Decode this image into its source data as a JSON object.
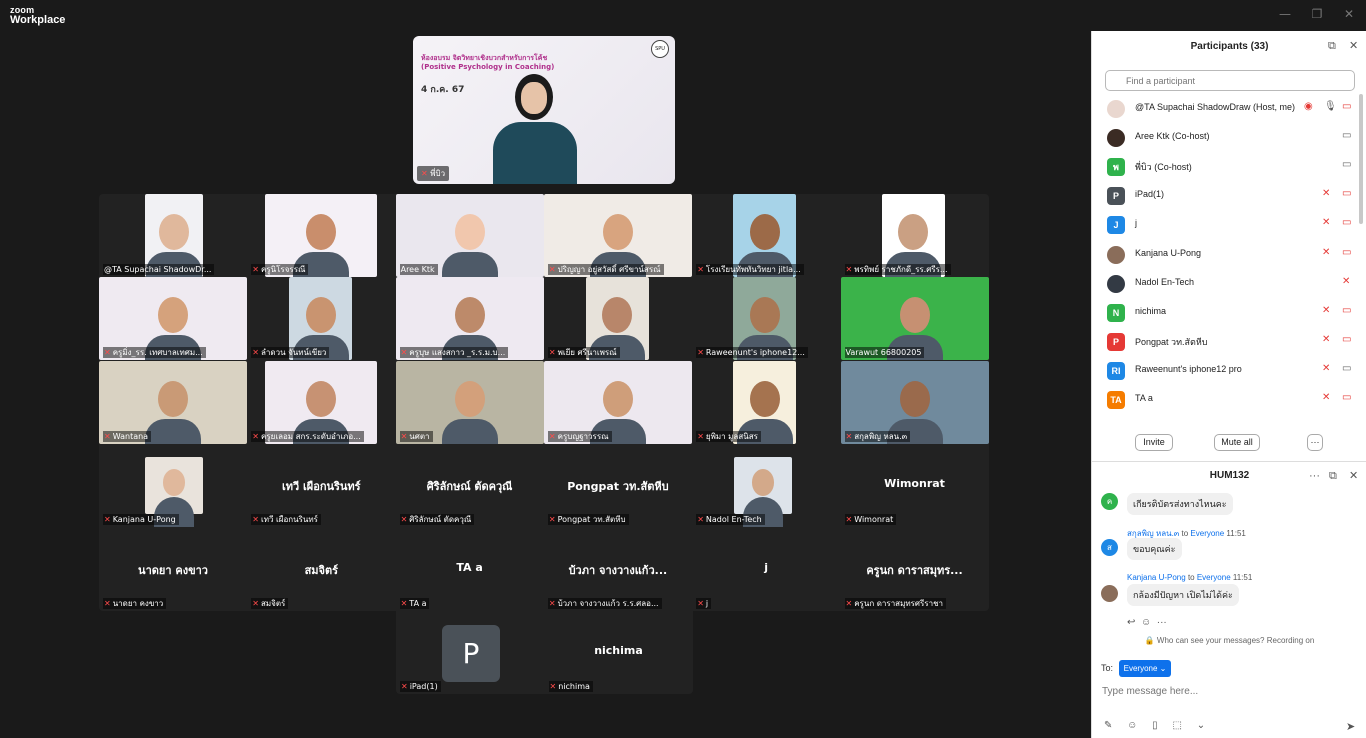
{
  "app": {
    "brand_line1": "zoom",
    "brand_line2": "Workplace"
  },
  "share": {
    "title": "ห้องอบรม จิตวิทยาเชิงบวกสำหรับการโค้ช (Positive Psychology in Coaching)",
    "date": "4 ก.ค. 67",
    "logo": "SPU",
    "presenter_label": "พี่บิว"
  },
  "tiles": [
    {
      "label": "@TA Supachai ShadowDr...",
      "muted": false
    },
    {
      "label": "ครูนิโรจรรณี",
      "muted": true
    },
    {
      "label": "Aree  Ktk",
      "muted": false
    },
    {
      "label": "ปริญญา อยู่สวัสดิ์ ศรีขาน์สรณ์",
      "muted": true
    },
    {
      "label": "โรงเรียนทัพทันวิทยา jitla...",
      "muted": true
    },
    {
      "label": "พรทิพย์ ราชภักดี_รร.ศรีร...",
      "muted": true
    },
    {
      "label": "ครูมิ่ง_รร. เทศบาลเทศม...",
      "muted": true
    },
    {
      "label": "ลำดวน จันทน์เขียว",
      "muted": true
    },
    {
      "label": "ครูบุษ แสงสกาว _ร.ร.ม.บ...",
      "muted": true
    },
    {
      "label": "พเยีย ศรีนาเพรณ์",
      "muted": true
    },
    {
      "label": "Raweenunt's iphone12...",
      "muted": true
    },
    {
      "label": "Varawut 66800205",
      "muted": false
    },
    {
      "label": "Wantana",
      "muted": true
    },
    {
      "label": "ครูยเลอม สกร.ระดับอำเภอ...",
      "muted": true
    },
    {
      "label": "นศตา",
      "muted": true
    },
    {
      "label": "ครูบญฐาวรรณ",
      "muted": true
    },
    {
      "label": "ยุพิมา มูลสนิสร",
      "muted": true
    },
    {
      "label": "สกุลพิญ หลน.๓",
      "muted": true
    },
    {
      "label": "Kanjana U-Pong",
      "muted": true
    },
    {
      "label": "เทวี เผือกนรินทร์",
      "muted": true,
      "big": "เทวี เผือกนรินทร์"
    },
    {
      "label": "ศิริลักษณ์ ตัดควุณี",
      "muted": true,
      "big": "ศิริลักษณ์ ตัดควุณี"
    },
    {
      "label": "Pongpat วท.สัตหีบ",
      "muted": true,
      "big": "Pongpat วท.สัตหีบ"
    },
    {
      "label": "Nadol En-Tech",
      "muted": true
    },
    {
      "label": "Wimonrat",
      "muted": true,
      "big": "Wimonrat"
    },
    {
      "label": "นาดยา คงขาว",
      "muted": true,
      "big": "นาดยา คงขาว"
    },
    {
      "label": "สมจิตร์",
      "muted": true,
      "big": "สมจิตร์"
    },
    {
      "label": "TA a",
      "muted": true,
      "big": "TA a"
    },
    {
      "label": "บ้วภา จางวางแก้ว ร.ร.ศลอ...",
      "muted": true,
      "big": "บ้วภา จางวางแก้ว..."
    },
    {
      "label": "j",
      "muted": true,
      "big": "j"
    },
    {
      "label": "ครูนก ดาราสมุทรศรีราชา",
      "muted": true,
      "big": "ครูนก ดาราสมุทร..."
    },
    {
      "label": "iPad(1)",
      "muted": true,
      "letter": "P"
    },
    {
      "label": "nichima",
      "muted": true,
      "big": "nichima"
    }
  ],
  "participants_panel": {
    "title": "Participants (33)",
    "search_placeholder": "Find a participant",
    "rows": [
      {
        "name": "@TA Supachai ShadowDraw (Host, me)",
        "avatar": "",
        "color": "#e9d7cf"
      },
      {
        "name": "Aree  Ktk (Co-host)",
        "avatar": "",
        "color": "#3b2b24"
      },
      {
        "name": "พี่บิว (Co-host)",
        "avatar": "พ",
        "color": "#2fb24c"
      },
      {
        "name": "iPad(1)",
        "avatar": "P",
        "color": "#4a5158"
      },
      {
        "name": "j",
        "avatar": "J",
        "color": "#1e88e5"
      },
      {
        "name": "Kanjana U-Pong",
        "avatar": "",
        "color": "#8a6d5a"
      },
      {
        "name": "Nadol En-Tech",
        "avatar": "",
        "color": "#333a44"
      },
      {
        "name": "nichima",
        "avatar": "N",
        "color": "#2fb24c"
      },
      {
        "name": "Pongpat วท.สัตหีบ",
        "avatar": "P",
        "color": "#e53935"
      },
      {
        "name": "Raweenunt's iphone12 pro",
        "avatar": "RI",
        "color": "#1e88e5"
      },
      {
        "name": "TA a",
        "avatar": "TA",
        "color": "#f57c00"
      }
    ],
    "invite_label": "Invite",
    "mute_all_label": "Mute all",
    "more_label": "···"
  },
  "chat": {
    "title": "HUM132",
    "messages": [
      {
        "avatar": "ค",
        "color": "#2fb24c",
        "sender": "",
        "to": "",
        "time": "",
        "text": "เกียรติบัตรส่งทางไหนคะ"
      },
      {
        "avatar": "ส",
        "color": "#1e88e5",
        "sender": "สกุลพิญ หลน.๓",
        "to": " to ",
        "everyone": "Everyone",
        "time": " 11:51",
        "text": "ขอบคุณค่ะ"
      },
      {
        "avatar": "",
        "color": "#8a6d5a",
        "sender": "Kanjana U-Pong",
        "to": " to ",
        "everyone": "Everyone",
        "time": " 11:51",
        "text": "กล้องมีปัญหา เปิดไม่ได้ค่ะ"
      }
    ],
    "visibility_note": "Who can see your messages? Recording on",
    "to_label": "To:",
    "to_value": "Everyone ⌄",
    "input_placeholder": "Type message here..."
  }
}
